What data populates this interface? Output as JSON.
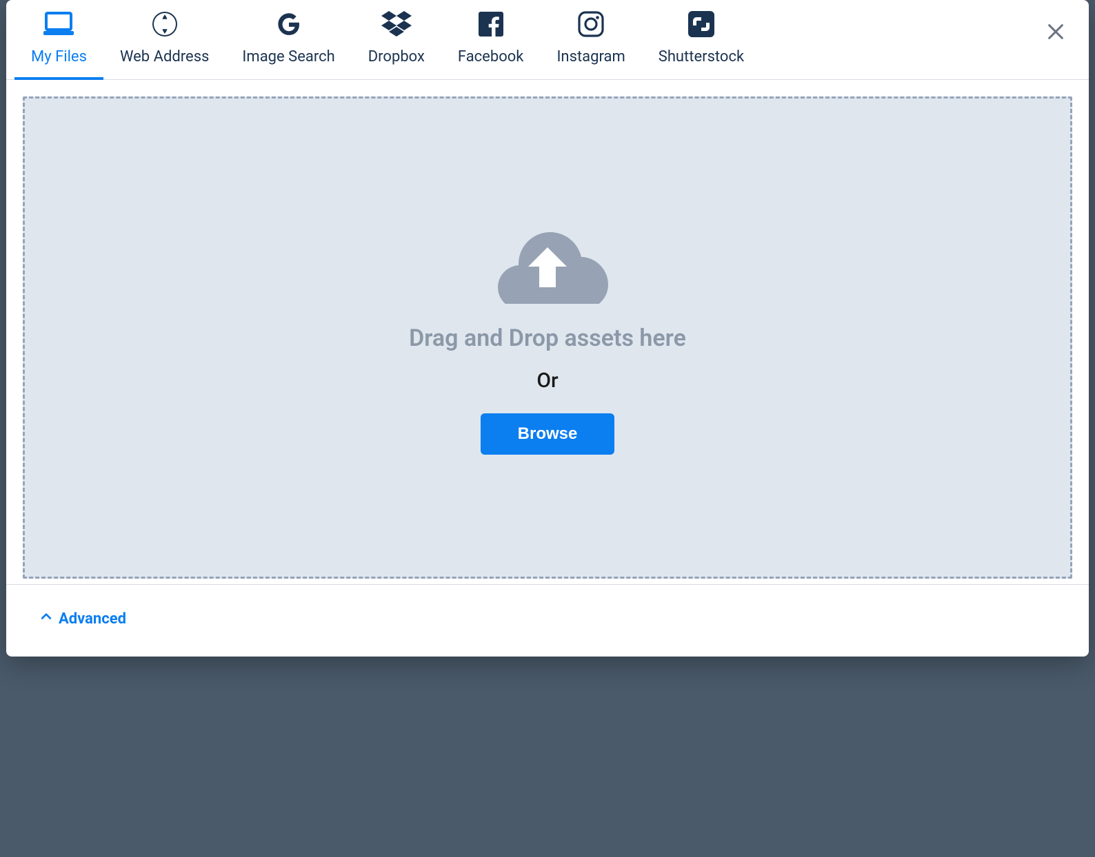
{
  "tabs": [
    {
      "id": "my-files",
      "label": "My Files",
      "icon": "laptop-icon",
      "active": true
    },
    {
      "id": "web-address",
      "label": "Web Address",
      "icon": "globe-icon",
      "active": false
    },
    {
      "id": "image-search",
      "label": "Image Search",
      "icon": "google-g-icon",
      "active": false
    },
    {
      "id": "dropbox",
      "label": "Dropbox",
      "icon": "dropbox-icon",
      "active": false
    },
    {
      "id": "facebook",
      "label": "Facebook",
      "icon": "facebook-icon",
      "active": false
    },
    {
      "id": "instagram",
      "label": "Instagram",
      "icon": "instagram-icon",
      "active": false
    },
    {
      "id": "shutterstock",
      "label": "Shutterstock",
      "icon": "shutterstock-icon",
      "active": false
    }
  ],
  "dropzone": {
    "drag_text": "Drag and Drop assets here",
    "or_text": "Or",
    "browse_label": "Browse"
  },
  "footer": {
    "advanced_label": "Advanced"
  },
  "colors": {
    "accent": "#0b7ef0",
    "tab_inactive": "#1b3350",
    "dropzone_bg": "#dfe6ee",
    "dropzone_border": "#94a3b8",
    "muted_text": "#8b98a7"
  }
}
